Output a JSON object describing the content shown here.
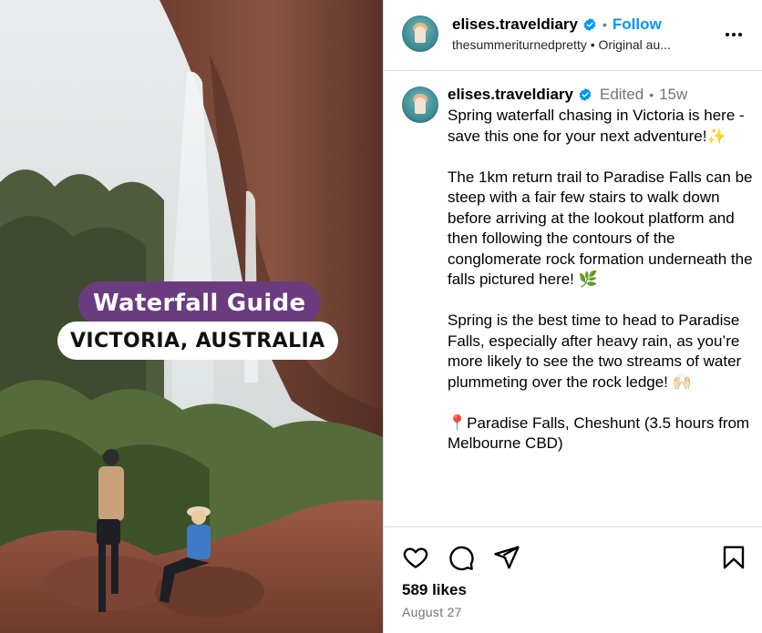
{
  "overlay": {
    "title": "Waterfall Guide",
    "subtitle": "VICTORIA, AUSTRALIA"
  },
  "header": {
    "username": "elises.traveldiary",
    "separator": "•",
    "follow_label": "Follow",
    "subline": "thesummeriturnedpretty • Original au..."
  },
  "caption": {
    "username": "elises.traveldiary",
    "edited": "Edited",
    "separator": "•",
    "age": "15w",
    "paragraphs": [
      "Spring waterfall chasing in Victoria is here - save this one for your next adventure!",
      "The 1km return trail to Paradise Falls can be steep with a fair few stairs to walk down before arriving at the lookout platform and then following the contours of the conglomerate rock formation underneath the falls pictured here!",
      "Spring is the best time to head to Paradise Falls, especially after heavy rain, as you’re more likely to see the two streams of water plummeting over the rock ledge!",
      "Paradise Falls, Cheshunt (3.5 hours from Melbourne CBD)"
    ],
    "emojis": [
      "✨",
      "🌿",
      "🙌🏻",
      "📍"
    ]
  },
  "footer": {
    "likes": "589 likes",
    "date": "August 27"
  },
  "icons": {
    "verified": "verified-badge-icon",
    "more": "more-options-icon",
    "like": "heart-icon",
    "comment": "comment-icon",
    "share": "share-icon",
    "save": "bookmark-icon"
  },
  "colors": {
    "accent": "#0095f6",
    "verified": "#0095f6",
    "muted": "#737373",
    "overlay_title_bg": "#6b3b80",
    "divider": "#dbdbdb"
  }
}
